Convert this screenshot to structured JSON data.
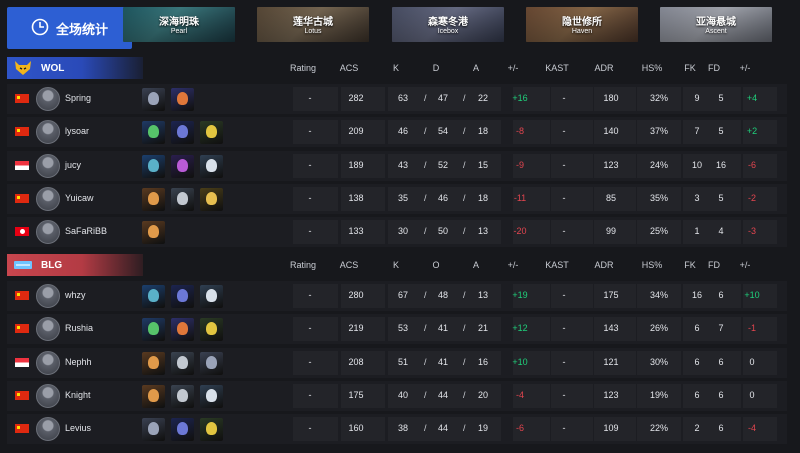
{
  "topbar": {
    "all_label": "全场统计",
    "maps": [
      {
        "cn": "深海明珠",
        "en": "Pearl"
      },
      {
        "cn": "莲华古城",
        "en": "Lotus"
      },
      {
        "cn": "森寒冬港",
        "en": "Icebox"
      },
      {
        "cn": "隐世修所",
        "en": "Haven"
      },
      {
        "cn": "亚海悬城",
        "en": "Ascent"
      }
    ]
  },
  "columns": [
    "Rating",
    "ACS",
    "K",
    "D",
    "A",
    "+/-",
    "KAST",
    "ADR",
    "HS%",
    "FK",
    "FD",
    "+/-"
  ],
  "columns_blg": [
    "Rating",
    "ACS",
    "K",
    "O",
    "A",
    "+/-",
    "KAST",
    "ADR",
    "HS%",
    "FK",
    "FD",
    "+/-"
  ],
  "teams": [
    {
      "name": "WOL",
      "players": [
        {
          "name": "Spring",
          "flag": "cn",
          "rating": "-",
          "acs": "282",
          "k": "63",
          "d": "47",
          "a": "22",
          "pm": "+16",
          "pm_sign": "pos",
          "kast": "-",
          "adr": "180",
          "hs": "32%",
          "fk": "9",
          "fd": "5",
          "fpm": "+4",
          "fpm_sign": "pos",
          "agents": [
            "kayo",
            "phoenix"
          ]
        },
        {
          "name": "lysoar",
          "flag": "cn",
          "rating": "-",
          "acs": "209",
          "k": "46",
          "d": "54",
          "a": "18",
          "pm": "-8",
          "pm_sign": "neg",
          "kast": "-",
          "adr": "140",
          "hs": "37%",
          "fk": "7",
          "fd": "5",
          "fpm": "+2",
          "fpm_sign": "pos",
          "agents": [
            "viper",
            "omen",
            "killjoy"
          ]
        },
        {
          "name": "jucy",
          "flag": "sg",
          "rating": "-",
          "acs": "189",
          "k": "43",
          "d": "52",
          "a": "15",
          "pm": "-9",
          "pm_sign": "neg",
          "kast": "-",
          "adr": "123",
          "hs": "24%",
          "fk": "10",
          "fd": "16",
          "fpm": "-6",
          "fpm_sign": "neg",
          "agents": [
            "harbor",
            "reyna",
            "jett"
          ]
        },
        {
          "name": "Yuicaw",
          "flag": "cn",
          "rating": "-",
          "acs": "138",
          "k": "35",
          "d": "46",
          "a": "18",
          "pm": "-11",
          "pm_sign": "neg",
          "kast": "-",
          "adr": "85",
          "hs": "35%",
          "fk": "3",
          "fd": "5",
          "fpm": "-2",
          "fpm_sign": "neg",
          "agents": [
            "breach",
            "sova",
            "raze"
          ]
        },
        {
          "name": "SaFaRiBB",
          "flag": "tn",
          "rating": "-",
          "acs": "133",
          "k": "30",
          "d": "50",
          "a": "13",
          "pm": "-20",
          "pm_sign": "neg",
          "kast": "-",
          "adr": "99",
          "hs": "25%",
          "fk": "1",
          "fd": "4",
          "fpm": "-3",
          "fpm_sign": "neg",
          "agents": [
            "breach"
          ]
        }
      ]
    },
    {
      "name": "BLG",
      "players": [
        {
          "name": "whzy",
          "flag": "cn",
          "rating": "-",
          "acs": "280",
          "k": "67",
          "d": "48",
          "a": "13",
          "pm": "+19",
          "pm_sign": "pos",
          "kast": "-",
          "adr": "175",
          "hs": "34%",
          "fk": "16",
          "fd": "6",
          "fpm": "+10",
          "fpm_sign": "pos",
          "agents": [
            "harbor",
            "omen",
            "jett"
          ]
        },
        {
          "name": "Rushia",
          "flag": "cn",
          "rating": "-",
          "acs": "219",
          "k": "53",
          "d": "41",
          "a": "21",
          "pm": "+12",
          "pm_sign": "pos",
          "kast": "-",
          "adr": "143",
          "hs": "26%",
          "fk": "6",
          "fd": "7",
          "fpm": "-1",
          "fpm_sign": "neg",
          "agents": [
            "viper",
            "phoenix",
            "killjoy"
          ]
        },
        {
          "name": "Nephh",
          "flag": "sg",
          "rating": "-",
          "acs": "208",
          "k": "51",
          "d": "41",
          "a": "16",
          "pm": "+10",
          "pm_sign": "pos",
          "kast": "-",
          "adr": "121",
          "hs": "30%",
          "fk": "6",
          "fd": "6",
          "fpm": "0",
          "fpm_sign": "neu",
          "agents": [
            "breach",
            "sova",
            "kayo"
          ]
        },
        {
          "name": "Knight",
          "flag": "cn",
          "rating": "-",
          "acs": "175",
          "k": "40",
          "d": "44",
          "a": "20",
          "pm": "-4",
          "pm_sign": "neg",
          "kast": "-",
          "adr": "123",
          "hs": "19%",
          "fk": "6",
          "fd": "6",
          "fpm": "0",
          "fpm_sign": "neu",
          "agents": [
            "breach",
            "sova",
            "jett"
          ]
        },
        {
          "name": "Levius",
          "flag": "cn",
          "rating": "-",
          "acs": "160",
          "k": "38",
          "d": "44",
          "a": "19",
          "pm": "-6",
          "pm_sign": "neg",
          "kast": "-",
          "adr": "109",
          "hs": "22%",
          "fk": "2",
          "fd": "6",
          "fpm": "-4",
          "fpm_sign": "neg",
          "agents": [
            "kayo",
            "omen",
            "killjoy"
          ]
        }
      ]
    }
  ],
  "colors": {
    "accent_blue": "#2d5fd3",
    "wol_blue": "#2f55c9",
    "blg_red": "#c8464e",
    "positive": "#1fcf7a",
    "negative": "#e2454f"
  }
}
